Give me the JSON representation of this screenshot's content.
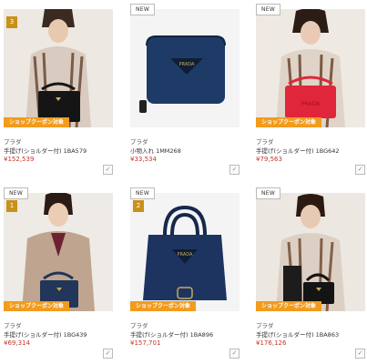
{
  "products": [
    {
      "badge_new": "",
      "rank": "3",
      "brand": "プラダ",
      "name": "手提げ(ショルダー付) 1BA579",
      "price": "¥152,539",
      "coupon": "ショップクーポン対象",
      "image_icon": "model-holding-black-tote-icon",
      "bag_color": "#151515"
    },
    {
      "badge_new": "NEW",
      "rank": "",
      "brand": "プラダ",
      "name": "小物入れ 1MM268",
      "price": "¥33,534",
      "coupon": "",
      "image_icon": "navy-zip-wallet-icon",
      "bag_color": "#1d3b66"
    },
    {
      "badge_new": "NEW",
      "rank": "",
      "brand": "プラダ",
      "name": "手提げ(ショルダー付) 1BG642",
      "price": "¥79,563",
      "coupon": "ショップクーポン対象",
      "image_icon": "model-holding-red-tote-icon",
      "bag_color": "#e0263a"
    },
    {
      "badge_new": "NEW",
      "rank": "1",
      "brand": "プラダ",
      "name": "手提げ(ショルダー付) 1BG439",
      "price": "¥69,314",
      "coupon": "ショップクーポン対象",
      "image_icon": "model-holding-navy-tote-icon",
      "bag_color": "#22365a"
    },
    {
      "badge_new": "NEW",
      "rank": "2",
      "brand": "プラダ",
      "name": "手提げ(ショルダー付) 1BA896",
      "price": "¥157,701",
      "coupon": "ショップクーポン対象",
      "image_icon": "navy-handbag-icon",
      "bag_color": "#1d3461"
    },
    {
      "badge_new": "NEW",
      "rank": "",
      "brand": "プラダ",
      "name": "手提げ(ショルダー付) 1BA863",
      "price": "¥176,126",
      "coupon": "ショップクーポン対象",
      "image_icon": "model-holding-black-handbag-icon",
      "bag_color": "#141414"
    }
  ],
  "colors": {
    "accent_coupon": "#f29b1c",
    "price_red": "#c0392b",
    "rank_gold": "#c8911a"
  }
}
